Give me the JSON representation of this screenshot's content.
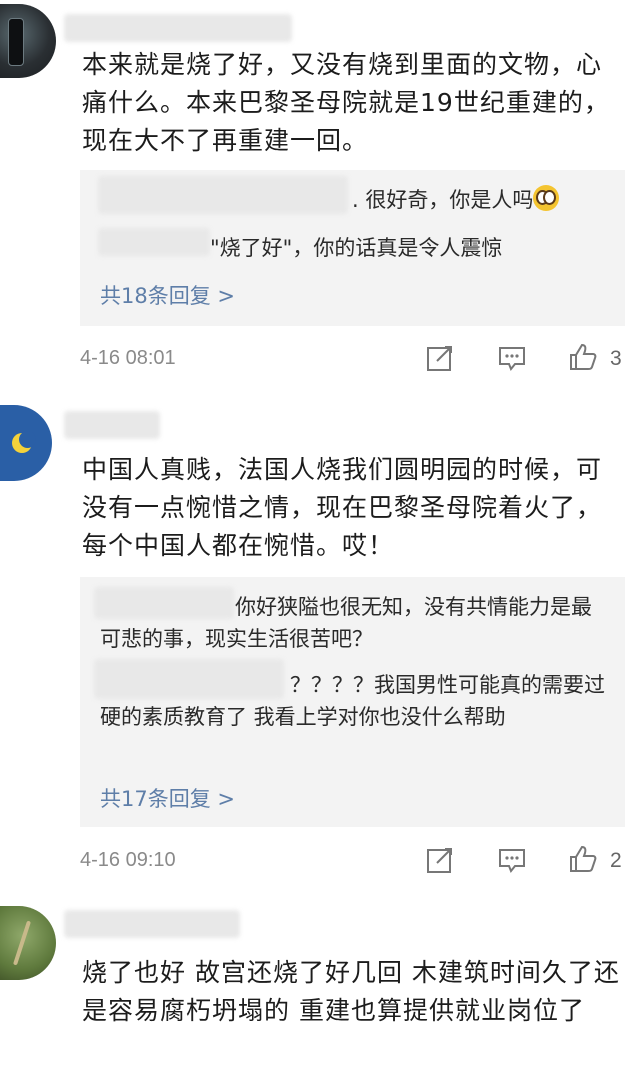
{
  "comments": [
    {
      "text": "本来就是烧了好，又没有烧到里面的文物，心痛什么。本来巴黎圣母院就是19世纪重建的，现在大不了再重建一回。",
      "replies": [
        ". 很好奇，你是人吗",
        "\"烧了好\"，你的话真是令人震惊"
      ],
      "reply_count": "共18条回复 >",
      "time": "4-16 08:01",
      "likes": "3"
    },
    {
      "text": "中国人真贱，法国人烧我们圆明园的时候，可没有一点惋惜之情，现在巴黎圣母院着火了，每个中国人都在惋惜。哎！",
      "replies": [
        "你好狭隘也很无知，没有共情能力是最可悲的事，现实生活很苦吧？",
        "？？？？我国男性可能真的需要过硬的素质教育了 我看上学对你也没什么帮助"
      ],
      "reply_count": "共17条回复 >",
      "time": "4-16 09:10",
      "likes": "2"
    },
    {
      "text": "烧了也好 故宫还烧了好几回 木建筑时间久了还是容易腐朽坍塌的 重建也算提供就业岗位了"
    }
  ],
  "icons": {
    "repost": "repost-icon",
    "comment": "comment-icon",
    "like": "thumbs-up-icon",
    "emoji": "flushed-face-emoji"
  },
  "colors": {
    "reply_count": "#5e7ea8",
    "reply_bg": "#f3f3f3",
    "meta": "#8a8a8a"
  }
}
